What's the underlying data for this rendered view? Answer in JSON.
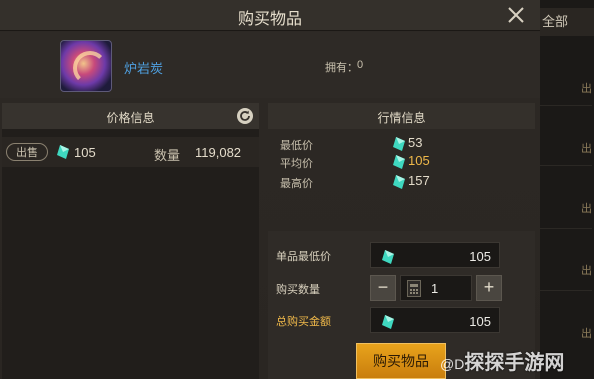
{
  "dialog": {
    "title": "购买物品",
    "close_icon": "close-icon"
  },
  "item": {
    "icon": "lava-coal-orb-icon",
    "name": "炉岩炭",
    "owned_label": "拥有：",
    "owned_value": "0"
  },
  "price_info": {
    "header": "价格信息",
    "refresh_icon": "refresh-icon",
    "listing": {
      "sell_label": "出售",
      "price": "105",
      "quantity_label": "数量",
      "quantity": "119,082"
    }
  },
  "market_info": {
    "header": "行情信息",
    "rows": [
      {
        "label": "最低价",
        "value": "53"
      },
      {
        "label": "平均价",
        "value": "105"
      },
      {
        "label": "最高价",
        "value": "157"
      }
    ]
  },
  "order": {
    "unit_price_label": "单品最低价",
    "unit_price": "105",
    "quantity_label": "购买数量",
    "quantity": "1",
    "minus_label": "−",
    "plus_label": "+",
    "total_label": "总购买金额",
    "total": "105",
    "buy_button": "购买物品"
  },
  "side_panel": {
    "tab_label": "全部",
    "chars": [
      "出",
      "出",
      "出",
      "出",
      "出",
      "出"
    ]
  },
  "watermark": {
    "text": "@D",
    "big_text": "探探手游网"
  },
  "colors": {
    "gem": "#3fd8c0",
    "accent": "#e8a31c",
    "average_price": "#f0b94a",
    "item_name": "#4fa0e0"
  }
}
